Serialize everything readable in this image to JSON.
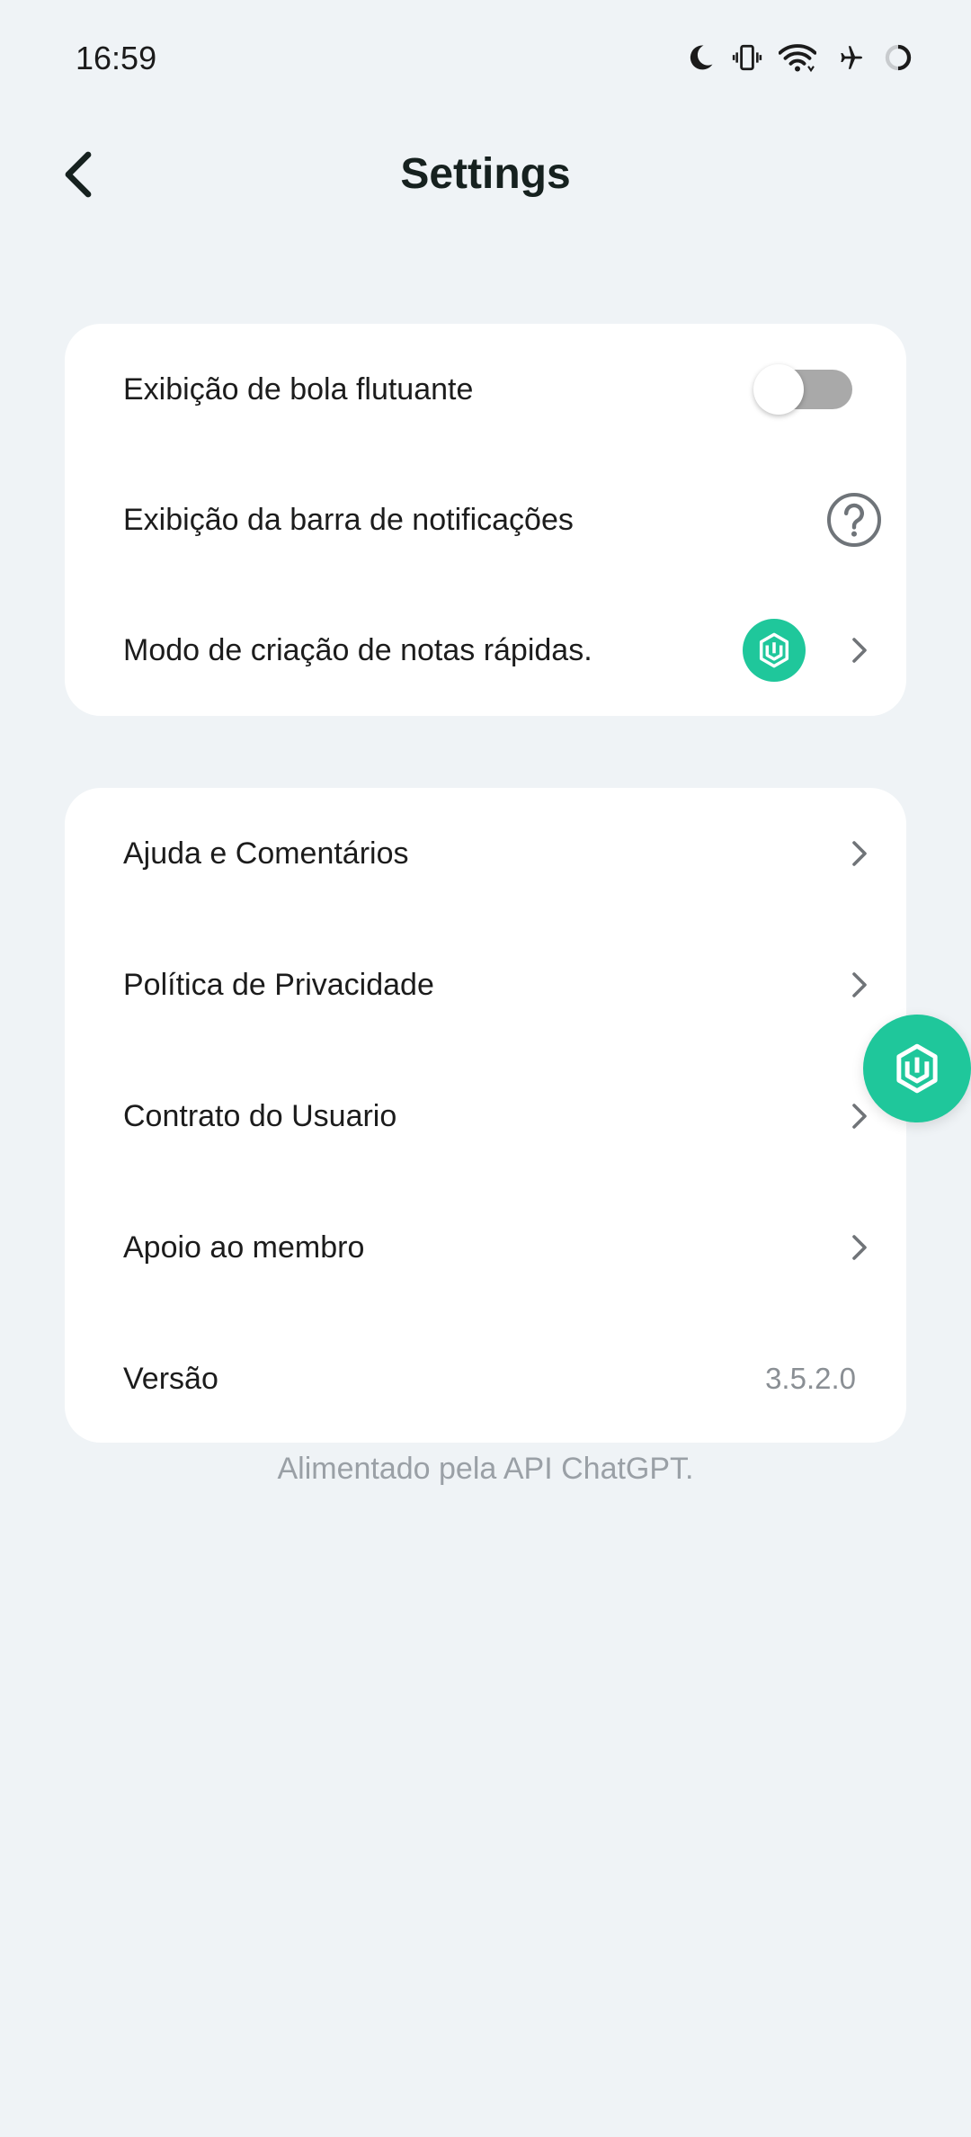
{
  "status_bar": {
    "time": "16:59",
    "icons": [
      "moon-icon",
      "vibrate-icon",
      "wifi-icon",
      "airplane-icon",
      "battery-saver-icon"
    ]
  },
  "header": {
    "title": "Settings",
    "back_icon": "chevron-left-icon"
  },
  "card_1": {
    "items": [
      {
        "label": "Exibição de bola flutuante",
        "control": "toggle",
        "toggle_on": false
      },
      {
        "label": "Exibição da barra de notificações",
        "control": "help-icon"
      },
      {
        "label": "Modo de criação de notas rápidas.",
        "control": "app-badge-and-chevron"
      }
    ]
  },
  "card_2": {
    "items": [
      {
        "label": "Ajuda e Comentários",
        "control": "chevron"
      },
      {
        "label": "Política de Privacidade",
        "control": "chevron"
      },
      {
        "label": "Contrato do Usuario",
        "control": "chevron"
      },
      {
        "label": "Apoio ao membro",
        "control": "chevron"
      },
      {
        "label": "Versão",
        "value": "3.5.2.0"
      }
    ]
  },
  "footer": {
    "note": "Alimentado pela API ChatGPT."
  },
  "colors": {
    "background": "#eff3f6",
    "card": "#ffffff",
    "accent": "#1fc79b",
    "toggle_off": "#a9a9a9",
    "muted_text": "#9aa0a6"
  }
}
